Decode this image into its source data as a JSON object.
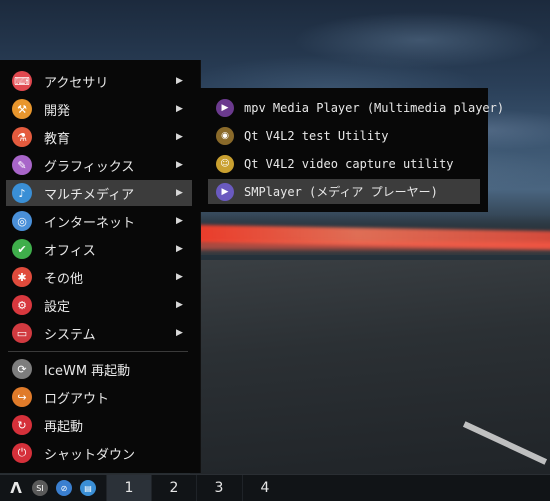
{
  "menu": {
    "items": [
      {
        "label": "アクセサリ",
        "icon": "accessories-icon",
        "color": "#e0484f",
        "glyph": "⌨",
        "arrow": true
      },
      {
        "label": "開発",
        "icon": "development-icon",
        "color": "#e8962d",
        "glyph": "⚒",
        "arrow": true
      },
      {
        "label": "教育",
        "icon": "education-icon",
        "color": "#e45b3e",
        "glyph": "⚗",
        "arrow": true
      },
      {
        "label": "グラフィックス",
        "icon": "graphics-icon",
        "color": "#a865c9",
        "glyph": "✎",
        "arrow": true
      },
      {
        "label": "マルチメディア",
        "icon": "multimedia-icon",
        "color": "#3a8fd6",
        "glyph": "♪",
        "arrow": true
      },
      {
        "label": "インターネット",
        "icon": "internet-icon",
        "color": "#4a90d9",
        "glyph": "◎",
        "arrow": true
      },
      {
        "label": "オフィス",
        "icon": "office-icon",
        "color": "#3fae4b",
        "glyph": "✔",
        "arrow": true
      },
      {
        "label": "その他",
        "icon": "other-icon",
        "color": "#e04b3c",
        "glyph": "✱",
        "arrow": true
      },
      {
        "label": "設定",
        "icon": "settings-icon",
        "color": "#d8383e",
        "glyph": "⚙",
        "arrow": true
      },
      {
        "label": "システム",
        "icon": "system-icon",
        "color": "#d13a40",
        "glyph": "▭",
        "arrow": true
      },
      {
        "label": "IceWM 再起動",
        "icon": "reload-icon",
        "color": "#7d7d7d",
        "glyph": "⟳",
        "arrow": false
      },
      {
        "label": "ログアウト",
        "icon": "logout-icon",
        "color": "#e07b2a",
        "glyph": "↪",
        "arrow": false
      },
      {
        "label": "再起動",
        "icon": "restart-icon",
        "color": "#d5303a",
        "glyph": "↻",
        "arrow": false
      },
      {
        "label": "シャットダウン",
        "icon": "shutdown-icon",
        "color": "#d5303a",
        "glyph": "⏻",
        "arrow": false
      }
    ],
    "active_index": 4
  },
  "submenu": {
    "items": [
      {
        "label": "mpv Media Player (Multimedia player)",
        "icon": "mpv-icon",
        "color": "#6b3a8e",
        "glyph": "▶"
      },
      {
        "label": "Qt V4L2 test Utility",
        "icon": "webcam-icon",
        "color": "#8a6a2a",
        "glyph": "◉"
      },
      {
        "label": "Qt V4L2 video capture utility",
        "icon": "capture-icon",
        "color": "#c9a030",
        "glyph": "☺"
      },
      {
        "label": "SMPlayer (メディア プレーヤー)",
        "icon": "smplayer-icon",
        "color": "#6a5ac0",
        "glyph": "▶"
      }
    ],
    "active_index": 3
  },
  "taskbar": {
    "start_glyph": "Λ",
    "tray": [
      {
        "name": "si-icon",
        "glyph": "SI",
        "color": "#5a5a5a"
      },
      {
        "name": "network-icon",
        "glyph": "⊘",
        "color": "#3a7fd0"
      },
      {
        "name": "files-icon",
        "glyph": "▤",
        "color": "#3a8fd6"
      }
    ],
    "workspaces": [
      "1",
      "2",
      "3",
      "4"
    ],
    "active_workspace": 0
  }
}
